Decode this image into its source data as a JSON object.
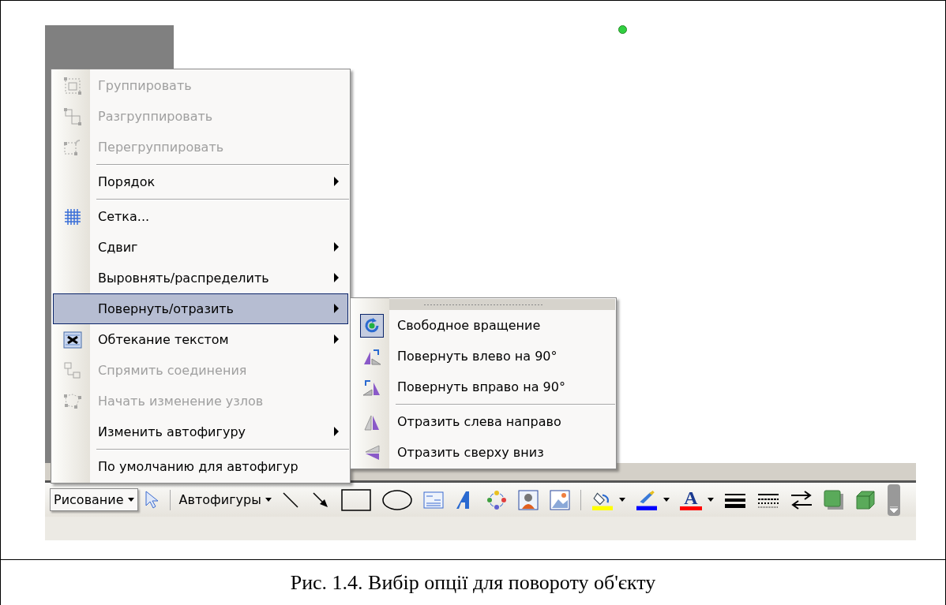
{
  "menu": {
    "items": [
      {
        "kind": "item",
        "label": "Группировать",
        "disabled": true,
        "submenu": false,
        "selected": false
      },
      {
        "kind": "item",
        "label": "Разгруппировать",
        "disabled": true,
        "submenu": false,
        "selected": false
      },
      {
        "kind": "item",
        "label": "Перегруппировать",
        "disabled": true,
        "submenu": false,
        "selected": false
      },
      {
        "kind": "separator"
      },
      {
        "kind": "item",
        "label": "Порядок",
        "disabled": false,
        "submenu": true,
        "selected": false
      },
      {
        "kind": "separator"
      },
      {
        "kind": "item",
        "label": "Сетка...",
        "disabled": false,
        "submenu": false,
        "selected": false
      },
      {
        "kind": "item",
        "label": "Сдвиг",
        "disabled": false,
        "submenu": true,
        "selected": false
      },
      {
        "kind": "item",
        "label": "Выровнять/распределить",
        "disabled": false,
        "submenu": true,
        "selected": false
      },
      {
        "kind": "item",
        "label": "Повернуть/отразить",
        "disabled": false,
        "submenu": true,
        "selected": true
      },
      {
        "kind": "item",
        "label": "Обтекание текстом",
        "disabled": false,
        "submenu": true,
        "selected": false
      },
      {
        "kind": "item",
        "label": "Спрямить соединения",
        "disabled": true,
        "submenu": false,
        "selected": false
      },
      {
        "kind": "item",
        "label": "Начать изменение узлов",
        "disabled": true,
        "submenu": false,
        "selected": false
      },
      {
        "kind": "item",
        "label": "Изменить автофигуру",
        "disabled": false,
        "submenu": true,
        "selected": false
      },
      {
        "kind": "separator"
      },
      {
        "kind": "item",
        "label": "По умолчанию для автофигур",
        "disabled": false,
        "submenu": false,
        "selected": false
      }
    ]
  },
  "submenu": {
    "items": [
      {
        "kind": "item",
        "label": "Свободное вращение",
        "checked": true
      },
      {
        "kind": "item",
        "label": "Повернуть влево на 90°",
        "checked": false
      },
      {
        "kind": "item",
        "label": "Повернуть вправо на 90°",
        "checked": false
      },
      {
        "kind": "separator"
      },
      {
        "kind": "item",
        "label": "Отразить слева направо",
        "checked": false
      },
      {
        "kind": "item",
        "label": "Отразить сверху вниз",
        "checked": false
      }
    ]
  },
  "toolbar": {
    "menu_buttons": [
      {
        "label": "Рисование",
        "pressed": true
      },
      {
        "label": "Автофигуры",
        "pressed": false
      }
    ],
    "color_tools": [
      {
        "kind": "fill",
        "color": "#ffff00"
      },
      {
        "kind": "line",
        "color": "#0000ff"
      },
      {
        "kind": "font",
        "glyph": "A",
        "color": "#ff0000"
      }
    ]
  },
  "caption": "Рис. 1.4. Вибір опції для повороту об'єкту"
}
